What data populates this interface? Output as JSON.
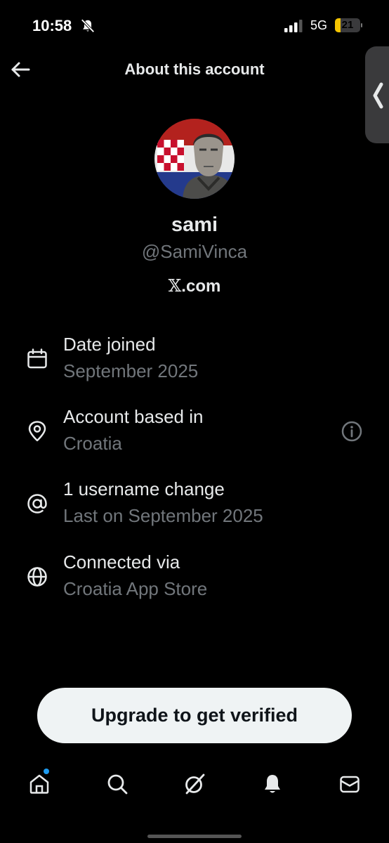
{
  "status_bar": {
    "time": "10:58",
    "network": "5G",
    "battery": "21",
    "battery_level": 0.21,
    "icons": [
      "bell-muted-icon",
      "signal-icon"
    ]
  },
  "header": {
    "title": "About this account",
    "back_icon": "back-arrow-icon"
  },
  "profile": {
    "display_name": "sami",
    "handle": "@SamiVinca",
    "platform_mark": "𝕏",
    "platform_suffix": ".com"
  },
  "info_rows": [
    {
      "icon": "calendar-icon",
      "label": "Date joined",
      "value": "September 2025"
    },
    {
      "icon": "location-pin-icon",
      "label": "Account based in",
      "value": "Croatia",
      "action_icon": "info-icon"
    },
    {
      "icon": "at-sign-icon",
      "label": "1 username change",
      "value": "Last on September 2025"
    },
    {
      "icon": "globe-icon",
      "label": "Connected via",
      "value": "Croatia App Store"
    }
  ],
  "upgrade_button": {
    "label": "Upgrade to get verified"
  },
  "tab_bar": [
    {
      "name": "home",
      "icon": "home-icon",
      "has_dot": true
    },
    {
      "name": "search",
      "icon": "search-icon"
    },
    {
      "name": "grok",
      "icon": "grok-icon"
    },
    {
      "name": "notifications",
      "icon": "bell-icon"
    },
    {
      "name": "messages",
      "icon": "mail-icon"
    }
  ],
  "colors": {
    "background": "#000000",
    "primary_text": "#e7e9ea",
    "secondary_text": "#71767b",
    "button_bg": "#eff3f4",
    "accent": "#1d9bf0",
    "battery": "#f5c400"
  }
}
